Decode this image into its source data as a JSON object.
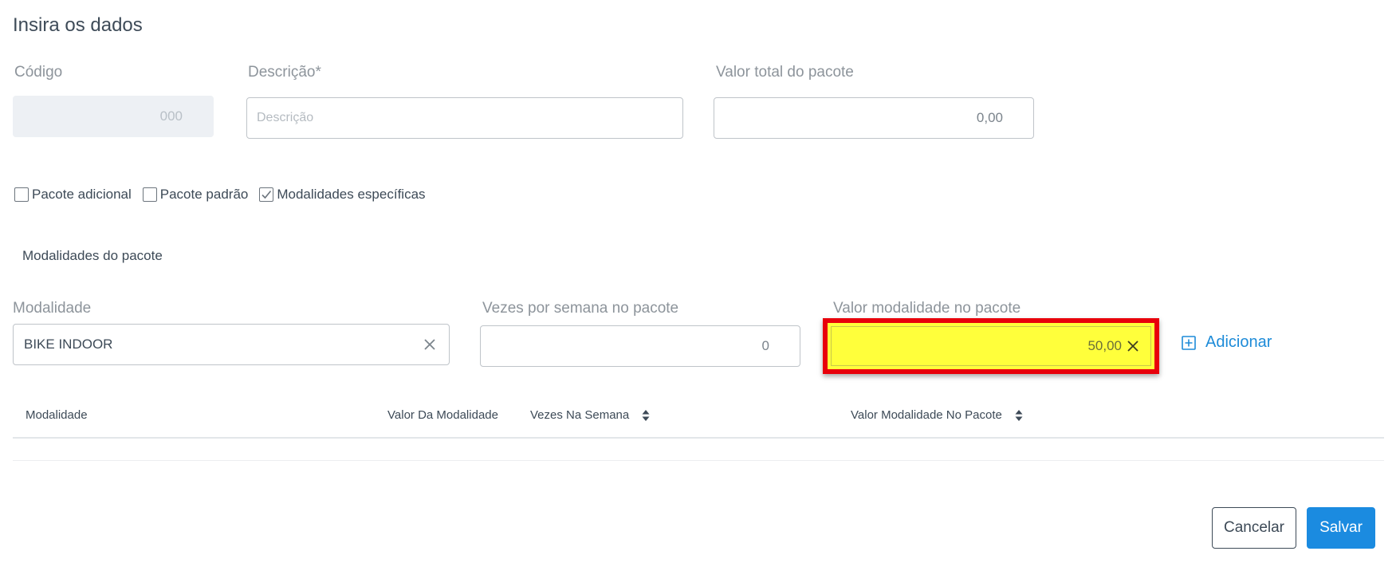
{
  "dialog": {
    "title": "Insira os dados"
  },
  "fields": {
    "codigo": {
      "label": "Código",
      "value": "000"
    },
    "descricao": {
      "label": "Descrição*",
      "placeholder": "Descrição"
    },
    "valor_total": {
      "label": "Valor total do pacote",
      "value": "0,00"
    }
  },
  "checkboxes": [
    {
      "label": "Pacote adicional",
      "checked": false
    },
    {
      "label": "Pacote padrão",
      "checked": false
    },
    {
      "label": "Modalidades específicas",
      "checked": true
    }
  ],
  "modalidades_section": {
    "label": "Modalidades do pacote",
    "modalidade": {
      "label": "Modalidade",
      "value": "BIKE INDOOR"
    },
    "vezes_semana": {
      "label": "Vezes por semana no pacote",
      "value": "0"
    },
    "valor_modalidade": {
      "label": "Valor modalidade no pacote",
      "value": "50,00"
    },
    "add_label": "Adicionar"
  },
  "table": {
    "columns": [
      {
        "label": "Modalidade",
        "sortable": false
      },
      {
        "label": "Valor Da Modalidade",
        "sortable": false
      },
      {
        "label": "Vezes Na Semana",
        "sortable": true
      },
      {
        "label": "Valor Modalidade No Pacote",
        "sortable": true
      }
    ],
    "rows": []
  },
  "actions": {
    "cancel": "Cancelar",
    "save": "Salvar"
  },
  "colors": {
    "primary": "#1b8be0",
    "highlight_fill": "#ffff3b",
    "highlight_border": "#e8000b"
  }
}
